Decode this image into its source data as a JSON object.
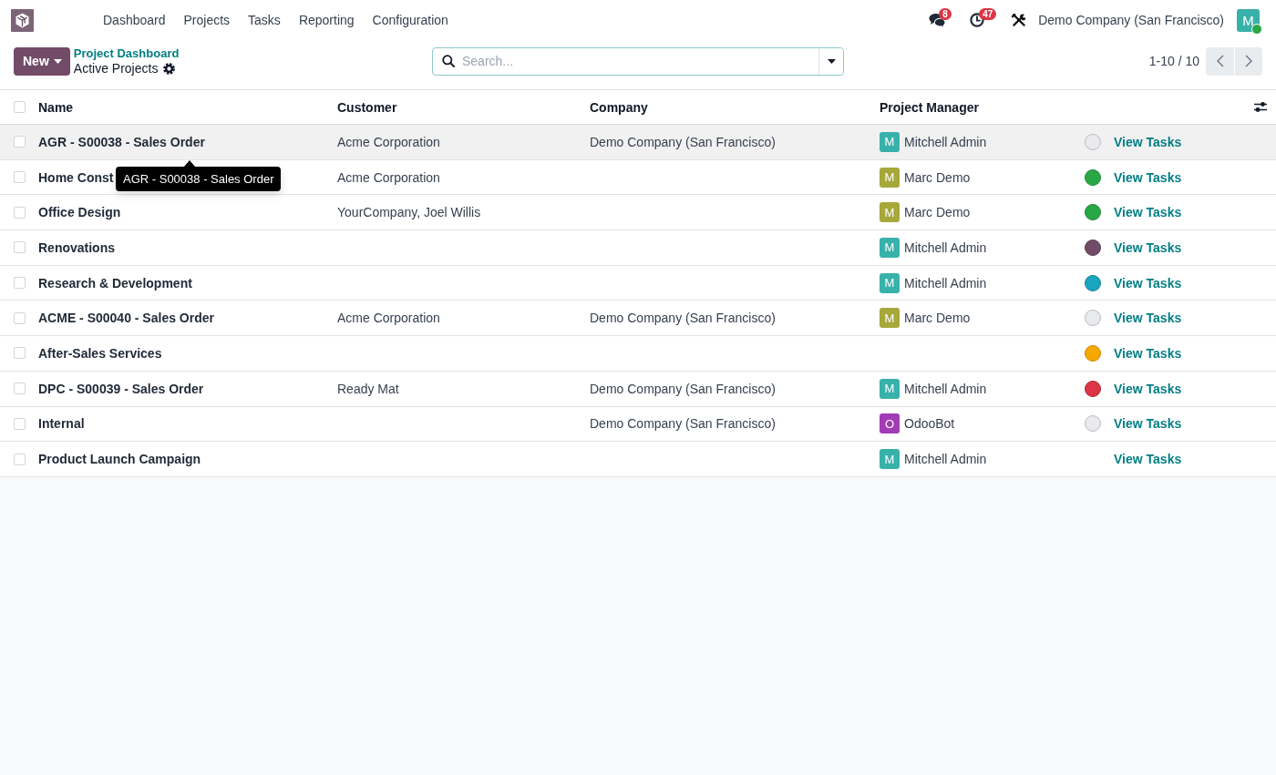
{
  "navbar": {
    "menu": [
      "Dashboard",
      "Projects",
      "Tasks",
      "Reporting",
      "Configuration"
    ],
    "notifications": [
      {
        "kind": "messages",
        "count": "8"
      },
      {
        "kind": "activities",
        "count": "47"
      }
    ],
    "company": "Demo Company (San Francisco)",
    "user": {
      "initial": "M",
      "online": true
    }
  },
  "control_panel": {
    "new_button": "New",
    "breadcrumb": [
      {
        "label": "Project Dashboard"
      }
    ],
    "title": "Active Projects",
    "search": {
      "placeholder": "Search..."
    },
    "pager": "1-10 / 10"
  },
  "table": {
    "header_checkbox": {
      "checked": false
    },
    "columns": [
      "Name",
      "Customer",
      "Company",
      "Project Manager"
    ],
    "rows": [
      {
        "checked": false,
        "hovered": true,
        "name": "AGR - S00038 - Sales Order",
        "customer": "Acme Corporation",
        "company": "Demo Company (San Francisco)",
        "manager": {
          "initial": "M",
          "name": "Mitchell Admin",
          "color": "#38b1aa"
        },
        "color": "#e9eaed",
        "action": "View Tasks",
        "tooltip": "AGR - S00038 - Sales Order"
      },
      {
        "checked": false,
        "hovered": false,
        "name": "Home Const",
        "customer": "Acme Corporation",
        "manager": {
          "initial": "M",
          "name": "Marc Demo",
          "color": "#a7a83a"
        },
        "color": "#28a745",
        "action": "View Tasks"
      },
      {
        "checked": false,
        "hovered": false,
        "name": "Office Design",
        "customer": "YourCompany, Joel Willis",
        "manager": {
          "initial": "M",
          "name": "Marc Demo",
          "color": "#a7a83a"
        },
        "color": "#28a745",
        "action": "View Tasks"
      },
      {
        "checked": false,
        "hovered": false,
        "name": "Renovations",
        "manager": {
          "initial": "M",
          "name": "Mitchell Admin",
          "color": "#38b1aa"
        },
        "color": "#714b67",
        "action": "View Tasks"
      },
      {
        "checked": false,
        "hovered": false,
        "name": "Research & Development",
        "manager": {
          "initial": "M",
          "name": "Mitchell Admin",
          "color": "#38b1aa"
        },
        "color": "#19a4bf",
        "action": "View Tasks"
      },
      {
        "checked": false,
        "hovered": false,
        "name": "ACME - S00040 - Sales Order",
        "customer": "Acme Corporation",
        "company": "Demo Company (San Francisco)",
        "manager": {
          "initial": "M",
          "name": "Marc Demo",
          "color": "#a7a83a"
        },
        "color": "#e9eaed",
        "action": "View Tasks"
      },
      {
        "checked": false,
        "hovered": false,
        "name": "After-Sales Services",
        "color": "#f7a800",
        "action": "View Tasks"
      },
      {
        "checked": false,
        "hovered": false,
        "name": "DPC - S00039 - Sales Order",
        "customer": "Ready Mat",
        "company": "Demo Company (San Francisco)",
        "manager": {
          "initial": "M",
          "name": "Mitchell Admin",
          "color": "#38b1aa"
        },
        "color": "#dc3545",
        "action": "View Tasks"
      },
      {
        "checked": false,
        "hovered": false,
        "name": "Internal",
        "company": "Demo Company (San Francisco)",
        "manager": {
          "initial": "O",
          "name": "OdooBot",
          "color": "#a23bb6"
        },
        "color": "#e9eaed",
        "action": "View Tasks"
      },
      {
        "checked": false,
        "hovered": false,
        "name": "Product Launch Campaign",
        "manager": {
          "initial": "M",
          "name": "Mitchell Admin",
          "color": "#38b1aa"
        },
        "action": "View Tasks"
      }
    ]
  }
}
